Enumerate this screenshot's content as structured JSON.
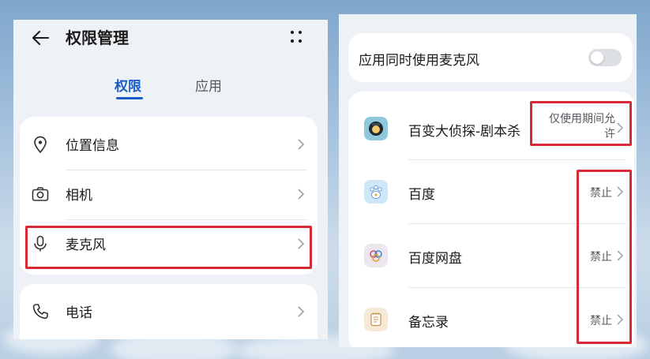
{
  "header": {
    "title": "权限管理"
  },
  "tabs": [
    {
      "label": "权限",
      "active": true
    },
    {
      "label": "应用",
      "active": false
    }
  ],
  "permissions": [
    {
      "label": "位置信息",
      "icon": "location-pin-icon"
    },
    {
      "label": "相机",
      "icon": "camera-icon"
    },
    {
      "label": "麦克风",
      "icon": "microphone-icon",
      "highlighted": true
    },
    {
      "label": "电话",
      "icon": "phone-icon"
    }
  ],
  "mic_page": {
    "concurrent_toggle": {
      "label": "应用同时使用麦克风",
      "enabled": false
    },
    "apps": [
      {
        "name": "百变大侦探-剧本杀",
        "status": "仅使用期间允许",
        "status_line1": "仅使用期间允",
        "status_line2": "许",
        "icon": "detective-app-icon"
      },
      {
        "name": "百度",
        "status": "禁止",
        "icon": "baidu-paw-icon"
      },
      {
        "name": "百度网盘",
        "status": "禁止",
        "icon": "baidu-netdisk-icon"
      },
      {
        "name": "备忘录",
        "status": "禁止",
        "icon": "notepad-icon"
      }
    ]
  },
  "colors": {
    "accent": "#1a5cc8",
    "highlight_box": "#d62b36",
    "card_bg": "#ffffff",
    "panel_bg": "#eef1f5",
    "text_primary": "#1b1b1b",
    "text_secondary": "#555a60"
  }
}
